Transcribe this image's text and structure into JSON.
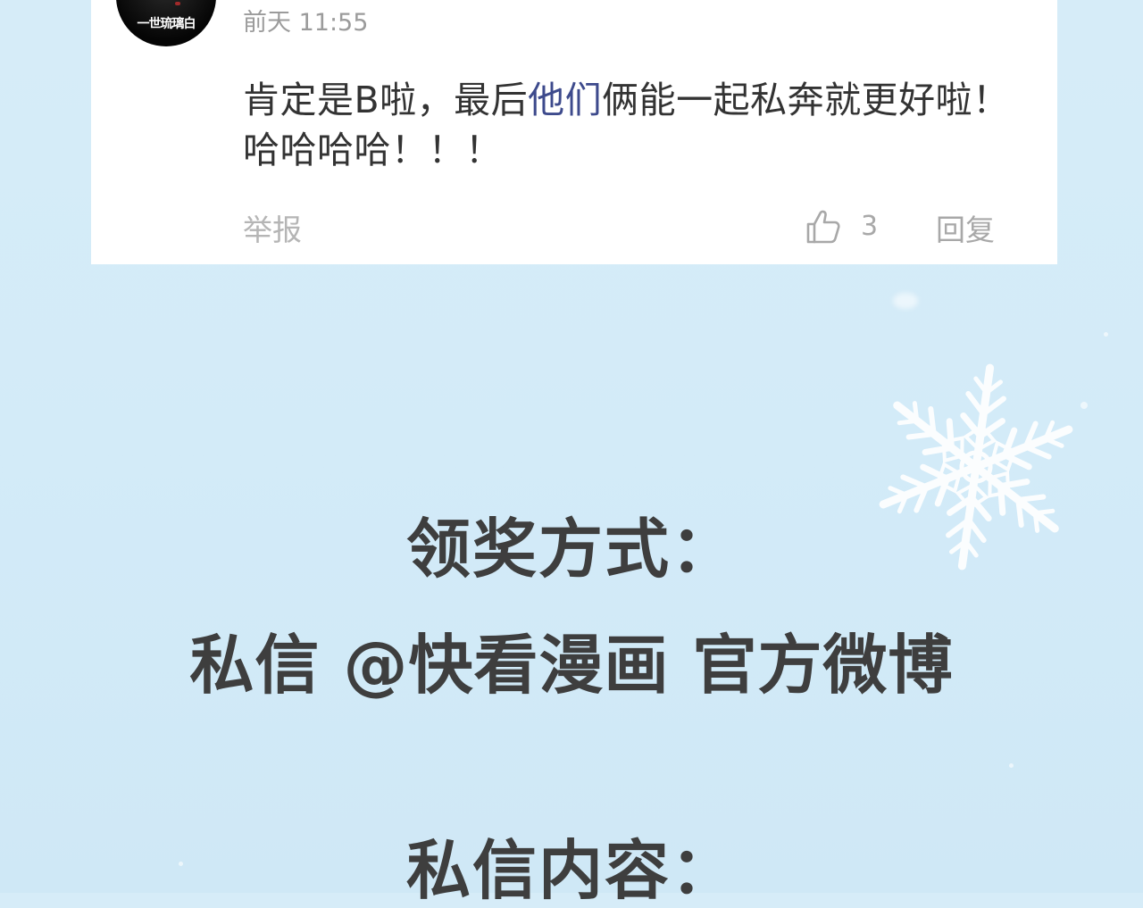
{
  "comment": {
    "avatar_text": "一世琉璃白",
    "timestamp": "前天 11:55",
    "text_parts": {
      "before": "肯定是B啦，最后",
      "highlight": "他们",
      "after": "俩能一起私奔就更好啦！哈哈哈哈！！！"
    },
    "report_label": "举报",
    "like_count": "3",
    "reply_label": "回复",
    "icons": {
      "like": "thumbs-up-icon"
    }
  },
  "decoration": {
    "snowflake_icon": "snowflake-icon",
    "text_color": "#3e3e3e",
    "background_color": "#d6ecf8"
  },
  "headings": {
    "prize_method": "领奖方式：",
    "private_message": "私信 @快看漫画 官方微博",
    "message_content": "私信内容："
  }
}
